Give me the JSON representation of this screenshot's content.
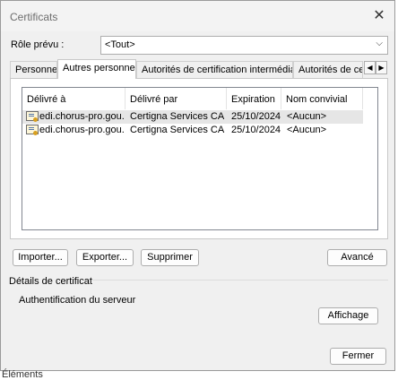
{
  "dialog": {
    "title": "Certificats",
    "close_glyph": "✕"
  },
  "role": {
    "label": "Rôle prévu :",
    "value": "<Tout>",
    "chevron": "⌵"
  },
  "tabs": [
    {
      "label": "Personnel"
    },
    {
      "label": "Autres personnes"
    },
    {
      "label": "Autorités de certification intermédiaires"
    },
    {
      "label": "Autorités de certification racines de confiance"
    }
  ],
  "tab_arrows": {
    "left": "◀",
    "right": "▶"
  },
  "list": {
    "columns": [
      "Délivré à",
      "Délivré par",
      "Expiration",
      "Nom convivial"
    ],
    "rows": [
      {
        "issued_to": "edi.chorus-pro.gou...",
        "issued_by": "Certigna Services CA",
        "expiration": "25/10/2024",
        "friendly": "<Aucun>",
        "icon": "certificate-icon"
      },
      {
        "issued_to": "edi.chorus-pro.gou...",
        "issued_by": "Certigna Services CA",
        "expiration": "25/10/2024",
        "friendly": "<Aucun>",
        "icon": "certificate-icon"
      }
    ]
  },
  "buttons": {
    "import": "Importer...",
    "export": "Exporter...",
    "remove": "Supprimer",
    "advanced": "Avancé",
    "view": "Affichage",
    "close": "Fermer"
  },
  "details": {
    "title": "Détails de certificat",
    "purposes": "Authentification du serveur"
  },
  "underlay_text": "Éléments"
}
